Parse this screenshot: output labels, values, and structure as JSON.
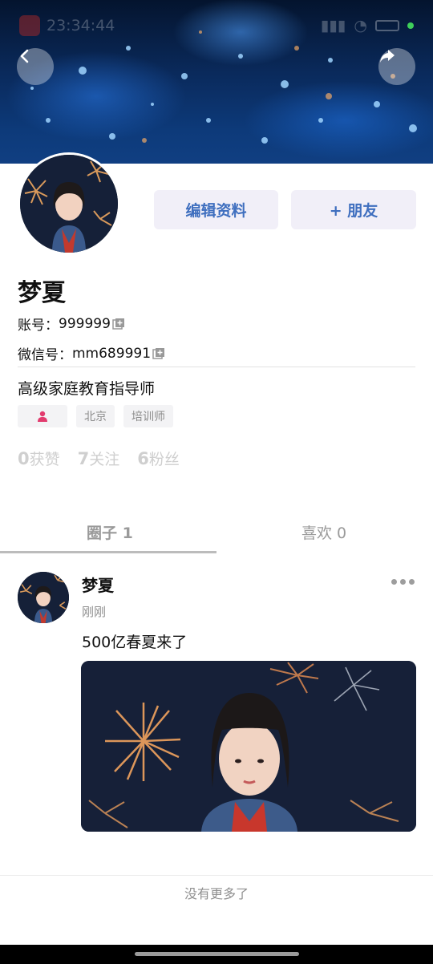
{
  "status_bar": {
    "time": "23:34:44"
  },
  "profile": {
    "name": "梦夏",
    "account_label": "账号：",
    "account_value": "999999",
    "wechat_label": "微信号：",
    "wechat_value": "mm689991",
    "title": "高级家庭教育指导师",
    "tags": [
      "北京",
      "培训师"
    ],
    "gender_icon": "person-icon"
  },
  "buttons": {
    "edit": "编辑资料",
    "add_friend": "+ 朋友"
  },
  "stats": [
    {
      "value": "0",
      "label": "获赞"
    },
    {
      "value": "7",
      "label": "关注"
    },
    {
      "value": "6",
      "label": "粉丝"
    }
  ],
  "tabs": [
    {
      "label": "圈子 1",
      "active": true
    },
    {
      "label": "喜欢 0",
      "active": false
    }
  ],
  "post": {
    "author": "梦夏",
    "time": "刚刚",
    "text": "500亿春夏来了"
  },
  "footer": {
    "no_more": "没有更多了"
  },
  "colors": {
    "accent": "#3f6fbf",
    "button_bg": "#f1eff8",
    "gender": "#e23b6e"
  }
}
